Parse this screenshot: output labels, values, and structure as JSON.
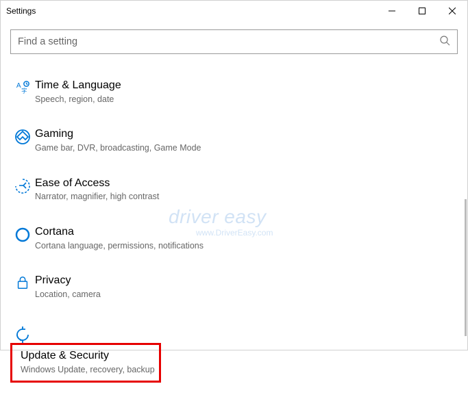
{
  "window": {
    "title": "Settings"
  },
  "search": {
    "placeholder": "Find a setting"
  },
  "items": [
    {
      "key": "time-language",
      "title": "Time & Language",
      "desc": "Speech, region, date"
    },
    {
      "key": "gaming",
      "title": "Gaming",
      "desc": "Game bar, DVR, broadcasting, Game Mode"
    },
    {
      "key": "ease-of-access",
      "title": "Ease of Access",
      "desc": "Narrator, magnifier, high contrast"
    },
    {
      "key": "cortana",
      "title": "Cortana",
      "desc": "Cortana language, permissions, notifications"
    },
    {
      "key": "privacy",
      "title": "Privacy",
      "desc": "Location, camera"
    },
    {
      "key": "update-security",
      "title": "Update & Security",
      "desc": "Windows Update, recovery, backup"
    }
  ],
  "watermark": {
    "line1": "driver easy",
    "line2": "www.DriverEasy.com"
  },
  "colors": {
    "accent": "#0078d7",
    "highlight_border": "#e60000"
  }
}
